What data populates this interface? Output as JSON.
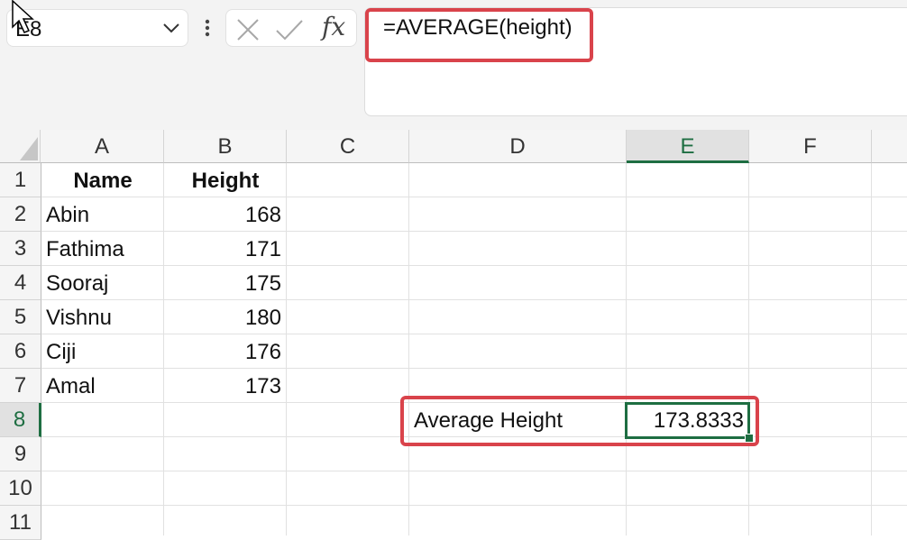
{
  "name_box": {
    "value": "E8"
  },
  "formula_bar": {
    "cancel_icon": "x-icon",
    "enter_icon": "check-icon",
    "fx_label": "fx",
    "formula": "=AVERAGE(height)"
  },
  "columns": [
    "A",
    "B",
    "C",
    "D",
    "E",
    "F"
  ],
  "active_column": "E",
  "rows": [
    "1",
    "2",
    "3",
    "4",
    "5",
    "6",
    "7",
    "8",
    "9",
    "10",
    "11"
  ],
  "active_row": "8",
  "table": {
    "headers": [
      "Name",
      "Height"
    ],
    "data": [
      [
        "Abin",
        "168"
      ],
      [
        "Fathima",
        "171"
      ],
      [
        "Sooraj",
        "175"
      ],
      [
        "Vishnu",
        "180"
      ],
      [
        "Ciji",
        "176"
      ],
      [
        "Amal",
        "173"
      ]
    ]
  },
  "result": {
    "label": "Average Height",
    "value": "173.8333"
  },
  "highlight_color": "#d9434b",
  "selection_color": "#1e6e42"
}
